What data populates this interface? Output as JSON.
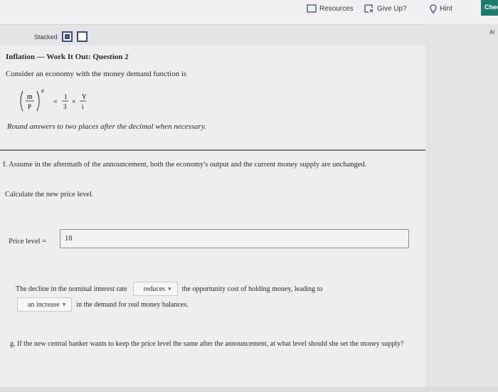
{
  "toolbar": {
    "resources_label": "Resources",
    "giveup_label": "Give Up?",
    "hint_label": "Hint",
    "check_label": "Check"
  },
  "side_tag": "Al",
  "view": {
    "stacked_label": "Stacked"
  },
  "problem": {
    "title": "Inflation — Work It Out: Question 2",
    "intro": "Consider an economy with the money demand function is",
    "formula": {
      "m": "m",
      "p": "P",
      "d": "d",
      "one": "1",
      "three": "3",
      "y": "Y",
      "i": "i",
      "eq": "=",
      "times": "×"
    },
    "round_note": "Round answers to two places after the decimal when necessary."
  },
  "part_f": {
    "question": "f. Assume in the aftermath of the announcement, both the economy's output and the current money supply are unchanged.",
    "calc_label": "Calculate the new price level.",
    "price_label": "Price level =",
    "price_value": "18",
    "sentence_1_before": "The decline in the nominal interest rate",
    "dropdown_1": "reduces",
    "sentence_1_after": "the opportunity cost of holding money, leading to",
    "dropdown_2": "an increase",
    "sentence_2_after": "in the demand for real money balances."
  },
  "part_g": {
    "question": "g. If the new central banker wants to keep the price level the same after the announcement, at what level should she set the money supply?"
  },
  "colors": {
    "check_button": "#1f7a6e",
    "view_box": "#3d4a7a",
    "divider": "#7b7f86"
  }
}
